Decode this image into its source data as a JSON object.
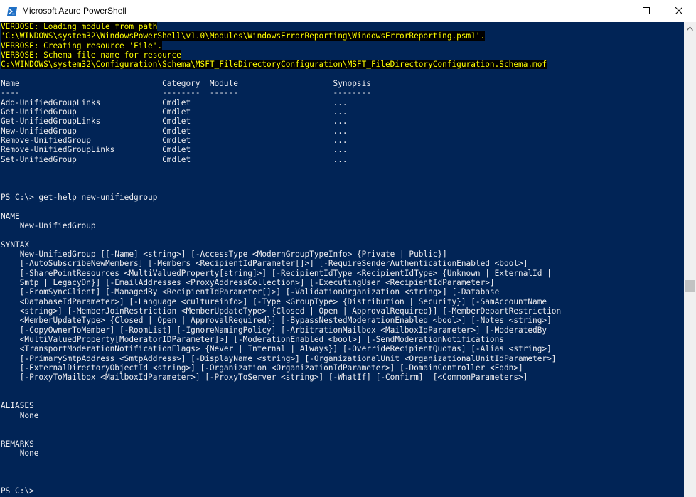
{
  "window": {
    "title": "Microsoft Azure PowerShell"
  },
  "colors": {
    "console_bg": "#012456",
    "console_fg": "#eeedf0",
    "verbose_fg": "#ffff00",
    "verbose_bg": "#000000"
  },
  "icons": {
    "app": "powershell-icon",
    "minimize": "minimize-icon",
    "maximize": "maximize-icon",
    "close": "close-icon",
    "scroll_up": "chevron-up-icon"
  },
  "console": {
    "verbose": [
      "VERBOSE: Loading module from path",
      "'C:\\WINDOWS\\system32\\WindowsPowerShell\\v1.0\\Modules\\WindowsErrorReporting\\WindowsErrorReporting.psm1'.",
      "VERBOSE: Creating resource 'File'.",
      "VERBOSE: Schema file name for resource",
      "C:\\WINDOWS\\system32\\Configuration\\Schema\\MSFT_FileDirectoryConfiguration\\MSFT_FileDirectoryConfiguration.Schema.mof"
    ],
    "table_header": "Name                              Category  Module                    Synopsis",
    "table_rule": "----                              --------  ------                    --------",
    "table_rows": [
      "Add-UnifiedGroupLinks             Cmdlet                              ...",
      "Get-UnifiedGroup                  Cmdlet                              ...",
      "Get-UnifiedGroupLinks             Cmdlet                              ...",
      "New-UnifiedGroup                  Cmdlet                              ...",
      "Remove-UnifiedGroup               Cmdlet                              ...",
      "Remove-UnifiedGroupLinks          Cmdlet                              ...",
      "Set-UnifiedGroup                  Cmdlet                              ..."
    ],
    "prompt_command": "PS C:\\> get-help new-unifiedgroup",
    "name_heading": "NAME",
    "name_value": "    New-UnifiedGroup",
    "syntax_heading": "SYNTAX",
    "syntax_lines": [
      "    New-UnifiedGroup [[-Name] <string>] [-AccessType <ModernGroupTypeInfo> {Private | Public}]",
      "    [-AutoSubscribeNewMembers] [-Members <RecipientIdParameter[]>] [-RequireSenderAuthenticationEnabled <bool>]",
      "    [-SharePointResources <MultiValuedProperty[string]>] [-RecipientIdType <RecipientIdType> {Unknown | ExternalId |",
      "    Smtp | LegacyDn}] [-EmailAddresses <ProxyAddressCollection>] [-ExecutingUser <RecipientIdParameter>]",
      "    [-FromSyncClient] [-ManagedBy <RecipientIdParameter[]>] [-ValidationOrganization <string>] [-Database",
      "    <DatabaseIdParameter>] [-Language <cultureinfo>] [-Type <GroupType> {Distribution | Security}] [-SamAccountName",
      "    <string>] [-MemberJoinRestriction <MemberUpdateType> {Closed | Open | ApprovalRequired}] [-MemberDepartRestriction",
      "    <MemberUpdateType> {Closed | Open | ApprovalRequired}] [-BypassNestedModerationEnabled <bool>] [-Notes <string>]",
      "    [-CopyOwnerToMember] [-RoomList] [-IgnoreNamingPolicy] [-ArbitrationMailbox <MailboxIdParameter>] [-ModeratedBy",
      "    <MultiValuedProperty[ModeratorIDParameter]>] [-ModerationEnabled <bool>] [-SendModerationNotifications",
      "    <TransportModerationNotificationFlags> {Never | Internal | Always}] [-OverrideRecipientQuotas] [-Alias <string>]",
      "    [-PrimarySmtpAddress <SmtpAddress>] [-DisplayName <string>] [-OrganizationalUnit <OrganizationalUnitIdParameter>]",
      "    [-ExternalDirectoryObjectId <string>] [-Organization <OrganizationIdParameter>] [-DomainController <Fqdn>]",
      "    [-ProxyToMailbox <MailboxIdParameter>] [-ProxyToServer <string>] [-WhatIf] [-Confirm]  [<CommonParameters>]"
    ],
    "aliases_heading": "ALIASES",
    "aliases_value": "    None",
    "remarks_heading": "REMARKS",
    "remarks_value": "    None",
    "final_prompt": "PS C:\\>"
  }
}
